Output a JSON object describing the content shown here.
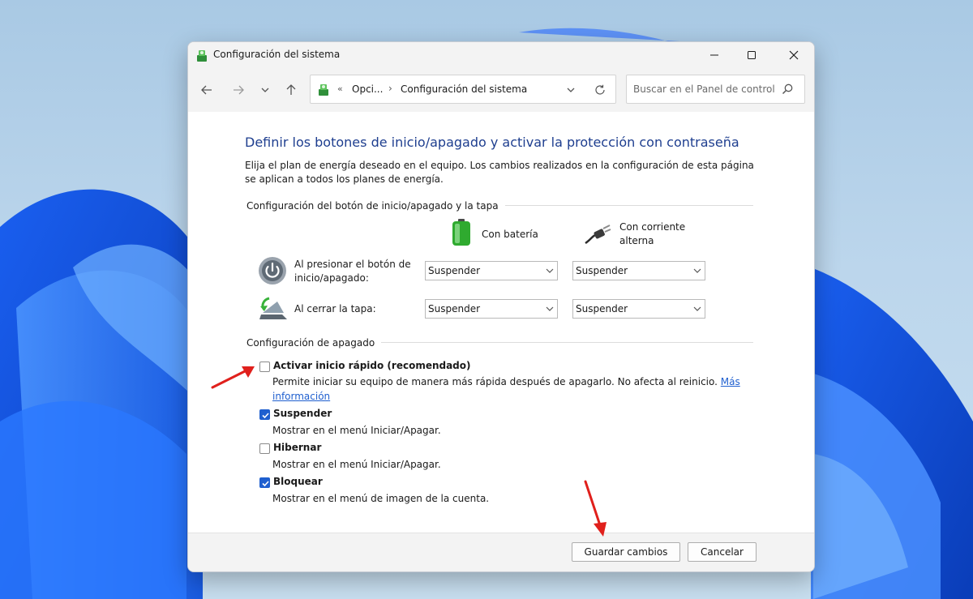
{
  "window": {
    "title": "Configuración del sistema"
  },
  "navbar": {
    "breadcrumb_first": "Opci...",
    "breadcrumb_current": "Configuración del sistema",
    "search_placeholder": "Buscar en el Panel de control"
  },
  "page": {
    "heading": "Definir los botones de inicio/apagado y activar la protección con contraseña",
    "description": "Elija el plan de energía deseado en el equipo. Los cambios realizados en la configuración de esta página se aplican a todos los planes de energía."
  },
  "power_buttons": {
    "section_label": "Configuración del botón de inicio/apagado y la tapa",
    "column_battery": "Con batería",
    "column_ac_line1": "Con corriente",
    "column_ac_line2": "alterna",
    "rows": [
      {
        "label_line1": "Al presionar el botón de",
        "label_line2": "inicio/apagado:",
        "battery_value": "Suspender",
        "ac_value": "Suspender"
      },
      {
        "label_line1": "Al cerrar la tapa:",
        "label_line2": "",
        "battery_value": "Suspender",
        "ac_value": "Suspender"
      }
    ]
  },
  "shutdown": {
    "section_label": "Configuración de apagado",
    "options": [
      {
        "title": "Activar inicio rápido (recomendado)",
        "checked": false,
        "desc": "Permite iniciar su equipo de manera más rápida después de apagarlo. No afecta al reinicio.",
        "link_part1": "Más",
        "link_part2": "información"
      },
      {
        "title": "Suspender",
        "checked": true,
        "desc": "Mostrar en el menú Iniciar/Apagar."
      },
      {
        "title": "Hibernar",
        "checked": false,
        "desc": "Mostrar en el menú Iniciar/Apagar."
      },
      {
        "title": "Bloquear",
        "checked": true,
        "desc": "Mostrar en el menú de imagen de la cuenta."
      }
    ]
  },
  "footer": {
    "save_label": "Guardar cambios",
    "cancel_label": "Cancelar"
  },
  "colors": {
    "accent": "#1f5fcf",
    "heading": "#1e3e8f",
    "annotation_arrow": "#e0201c"
  }
}
